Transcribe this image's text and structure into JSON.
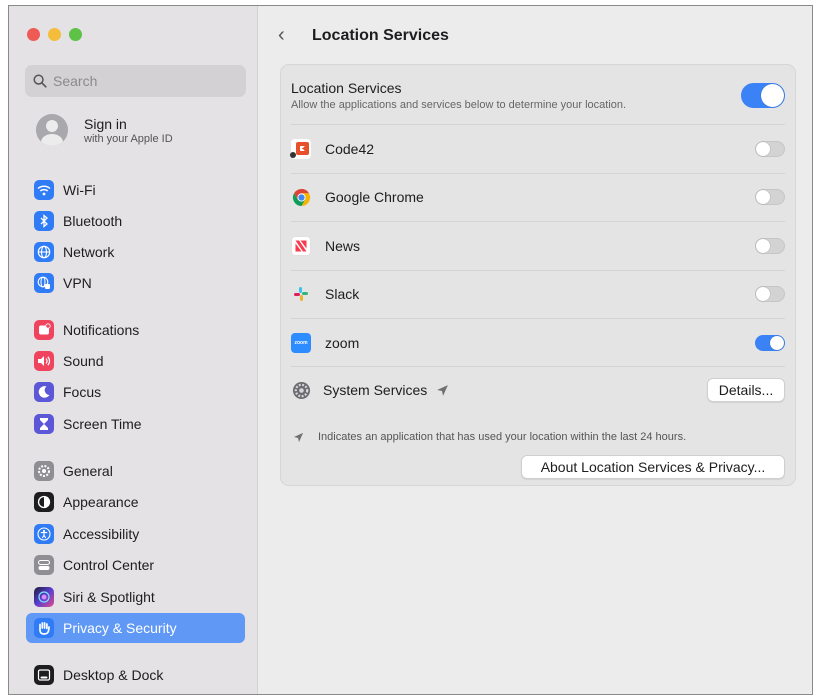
{
  "sidebar": {
    "search_placeholder": "Search",
    "signin": {
      "title": "Sign in",
      "subtitle": "with your Apple ID"
    },
    "items": [
      {
        "label": "Wi-Fi",
        "icon": "wifi-icon",
        "color": "#2f7cf6"
      },
      {
        "label": "Bluetooth",
        "icon": "bluetooth-icon",
        "color": "#2f7cf6"
      },
      {
        "label": "Network",
        "icon": "globe-icon",
        "color": "#2f7cf6"
      },
      {
        "label": "VPN",
        "icon": "vpn-globe-icon",
        "color": "#2f7cf6"
      },
      {
        "label": "Notifications",
        "icon": "bell-icon",
        "color": "#f0435e"
      },
      {
        "label": "Sound",
        "icon": "speaker-icon",
        "color": "#f0435e"
      },
      {
        "label": "Focus",
        "icon": "moon-icon",
        "color": "#5b57d6"
      },
      {
        "label": "Screen Time",
        "icon": "hourglass-icon",
        "color": "#5b57d6"
      },
      {
        "label": "General",
        "icon": "gear-icon",
        "color": "#8e8e93"
      },
      {
        "label": "Appearance",
        "icon": "appearance-icon",
        "color": "#1d1d1f"
      },
      {
        "label": "Accessibility",
        "icon": "accessibility-icon",
        "color": "#2f7cf6"
      },
      {
        "label": "Control Center",
        "icon": "control-center-icon",
        "color": "#8e8e93"
      },
      {
        "label": "Siri & Spotlight",
        "icon": "siri-icon",
        "color": "#5a3fd1"
      },
      {
        "label": "Privacy & Security",
        "icon": "hand-icon",
        "color": "#2f7cf6"
      },
      {
        "label": "Desktop & Dock",
        "icon": "dock-icon",
        "color": "#1d1d1f"
      }
    ],
    "selected": "Privacy & Security"
  },
  "header": {
    "back_label": "‹",
    "title": "Location Services"
  },
  "location": {
    "title": "Location Services",
    "description": "Allow the applications and services below to determine your location.",
    "enabled": true
  },
  "apps": [
    {
      "name": "Code42",
      "icon": "code42-icon",
      "enabled": false
    },
    {
      "name": "Google Chrome",
      "icon": "chrome-icon",
      "enabled": false
    },
    {
      "name": "News",
      "icon": "news-icon",
      "enabled": false
    },
    {
      "name": "Slack",
      "icon": "slack-icon",
      "enabled": false
    },
    {
      "name": "zoom",
      "icon": "zoom-icon",
      "enabled": true
    }
  ],
  "system_services": {
    "name": "System Services",
    "details_label": "Details..."
  },
  "note": "Indicates an application that has used your location within the last 24 hours.",
  "about_label": "About Location Services & Privacy..."
}
